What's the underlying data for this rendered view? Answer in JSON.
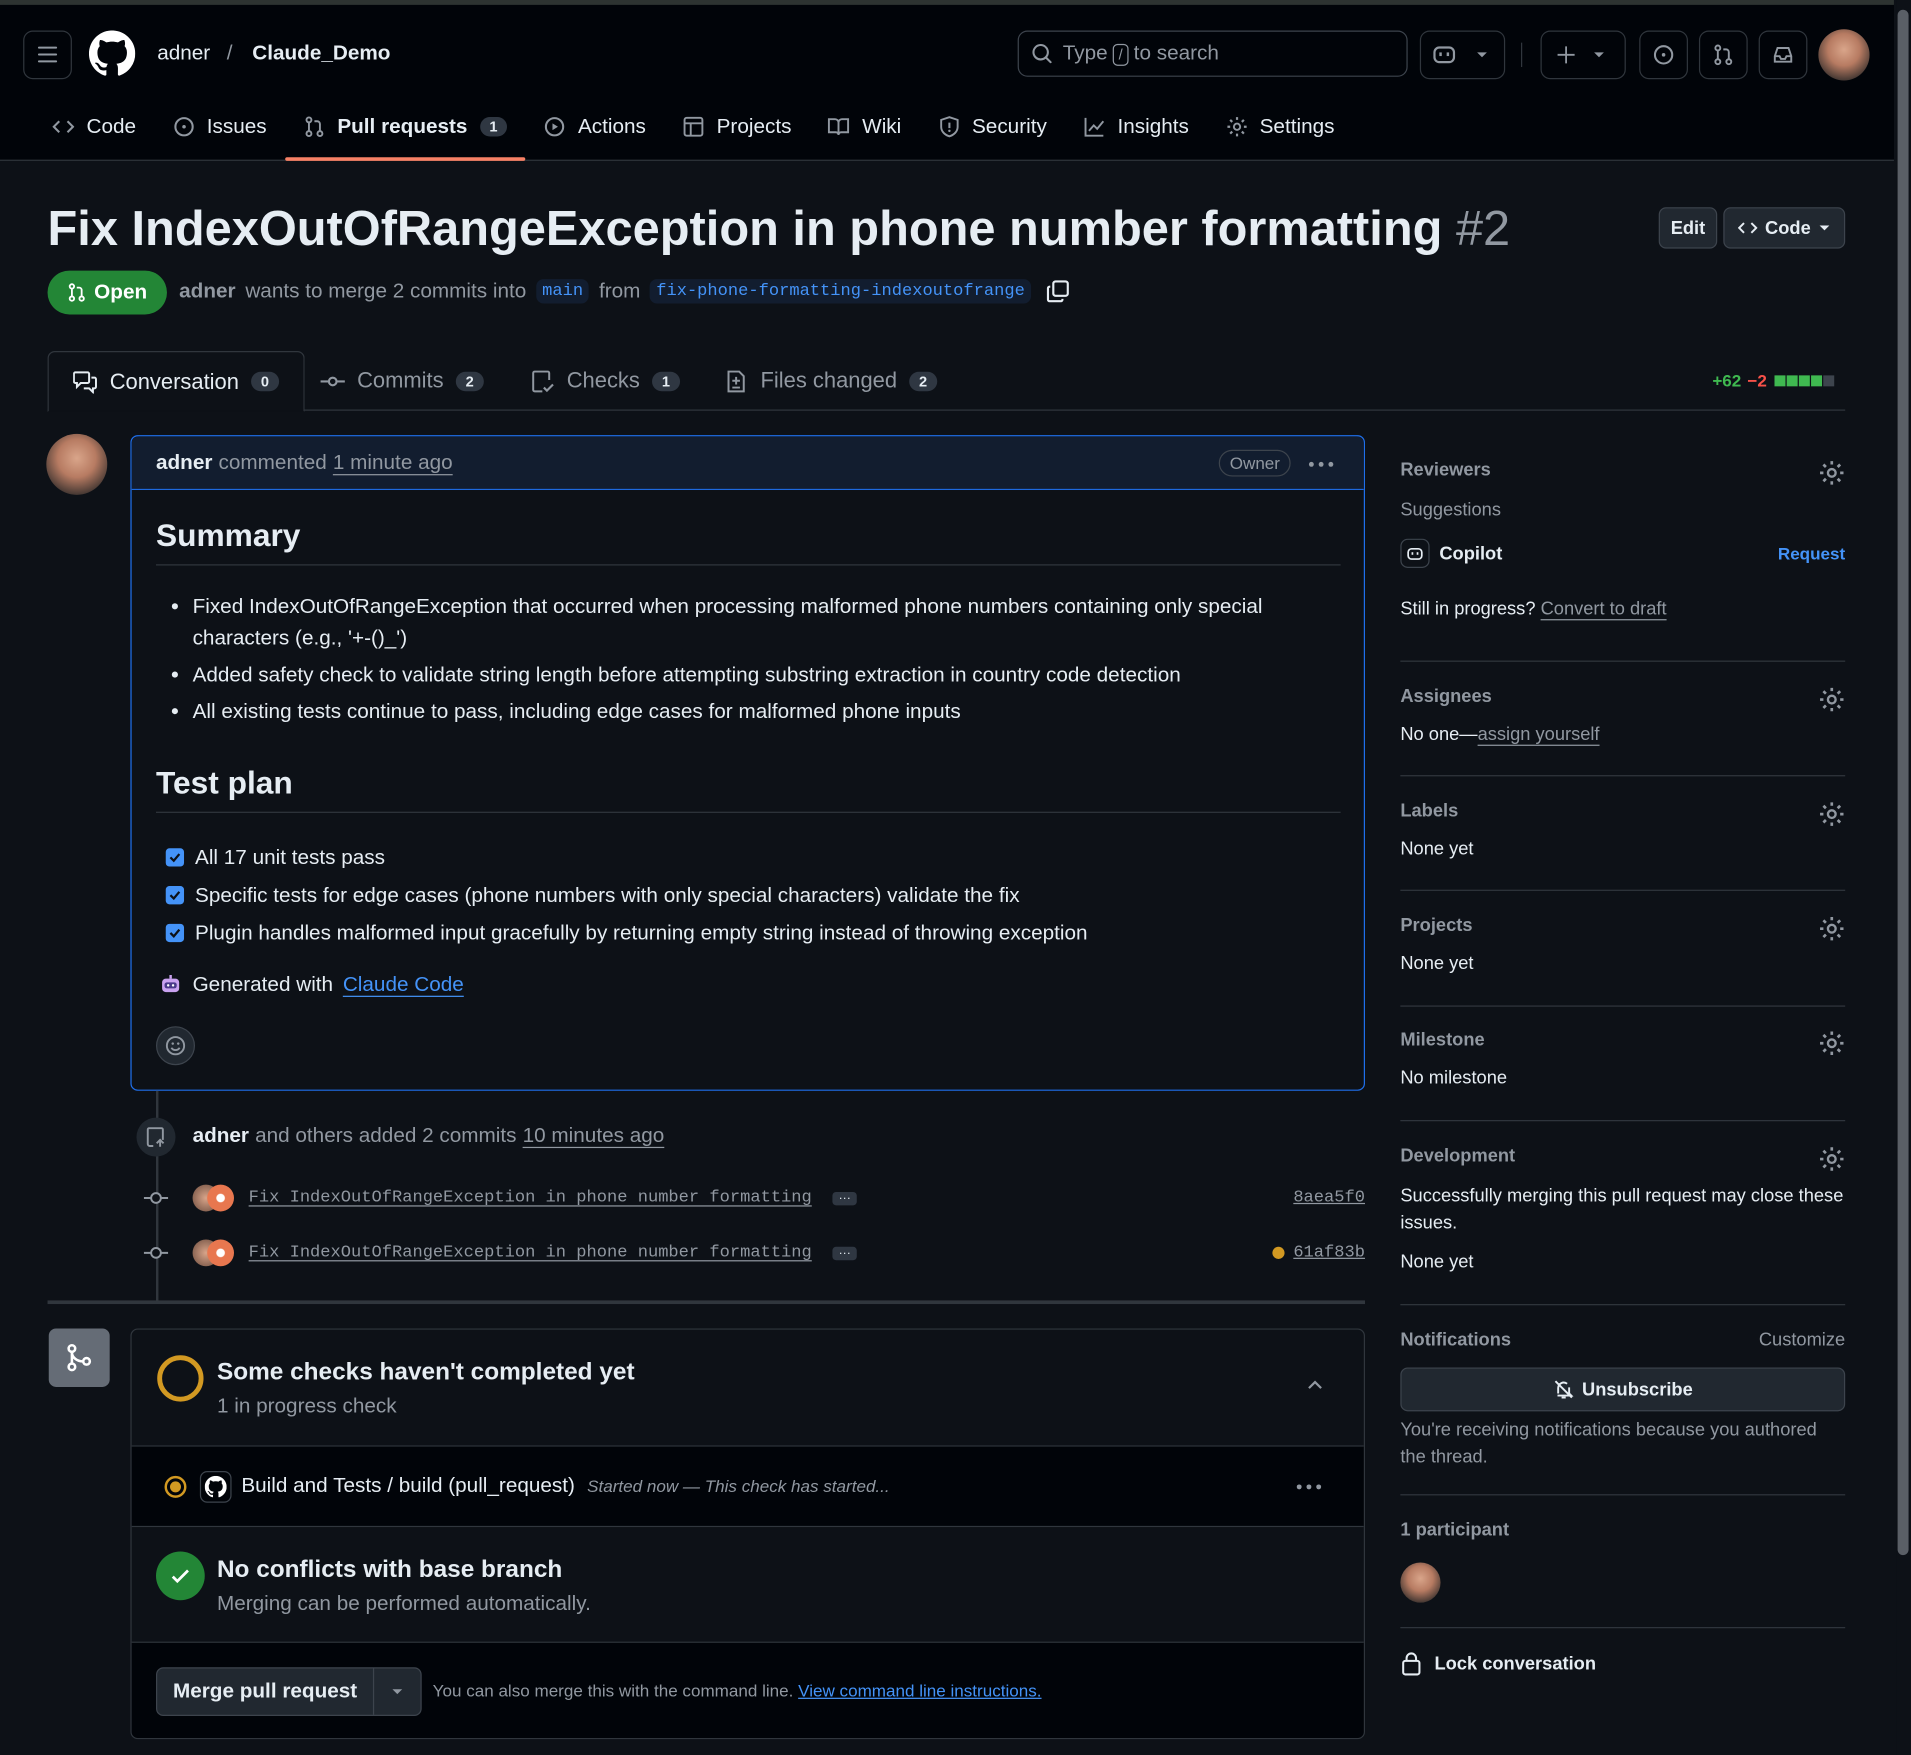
{
  "header": {
    "owner": "adner",
    "separator": "/",
    "repo": "Claude_Demo",
    "search": {
      "prefix": "Type",
      "key": "/",
      "suffix": "to search"
    }
  },
  "repo_tabs": [
    {
      "label": "Code",
      "icon": "code-icon"
    },
    {
      "label": "Issues",
      "icon": "issue-icon"
    },
    {
      "label": "Pull requests",
      "icon": "pull-request-icon",
      "count": "1",
      "active": true
    },
    {
      "label": "Actions",
      "icon": "play-icon"
    },
    {
      "label": "Projects",
      "icon": "table-icon"
    },
    {
      "label": "Wiki",
      "icon": "book-icon"
    },
    {
      "label": "Security",
      "icon": "shield-icon"
    },
    {
      "label": "Insights",
      "icon": "graph-icon"
    },
    {
      "label": "Settings",
      "icon": "gear-icon"
    }
  ],
  "pr": {
    "title": "Fix IndexOutOfRangeException in phone number formatting",
    "number": "#2",
    "edit_label": "Edit",
    "code_label": "Code",
    "state": "Open",
    "author": "adner",
    "merge_text": "wants to merge 2 commits into",
    "base": "main",
    "from_text": "from",
    "head": "fix-phone-formatting-indexoutofrange"
  },
  "pr_tabs": [
    {
      "label": "Conversation",
      "count": "0",
      "active": true
    },
    {
      "label": "Commits",
      "count": "2"
    },
    {
      "label": "Checks",
      "count": "1"
    },
    {
      "label": "Files changed",
      "count": "2"
    }
  ],
  "diffstat": {
    "additions": "+62",
    "deletions": "−2"
  },
  "comment": {
    "author": "adner",
    "action": "commented",
    "time": "1 minute ago",
    "badge": "Owner",
    "summary_heading": "Summary",
    "bullets": [
      "Fixed IndexOutOfRangeException that occurred when processing malformed phone numbers containing only special characters (e.g., '+-()_')",
      "Added safety check to validate string length before attempting substring extraction in country code detection",
      "All existing tests continue to pass, including edge cases for malformed phone inputs"
    ],
    "testplan_heading": "Test plan",
    "tasks": [
      "All 17 unit tests pass",
      "Specific tests for edge cases (phone numbers with only special characters) validate the fix",
      "Plugin handles malformed input gracefully by returning empty string instead of throwing exception"
    ],
    "generated_prefix": "Generated with",
    "generated_link": "Claude Code"
  },
  "commits_event": {
    "author": "adner",
    "text": "and others added 2 commits",
    "time": "10 minutes ago",
    "commits": [
      {
        "message": "Fix IndexOutOfRangeException in phone number formatting",
        "sha": "8aea5f0",
        "pending": false
      },
      {
        "message": "Fix IndexOutOfRangeException in phone number formatting",
        "sha": "61af83b",
        "pending": true
      }
    ]
  },
  "merge": {
    "checks_title": "Some checks haven't completed yet",
    "checks_sub": "1 in progress check",
    "check_name": "Build and Tests / build (pull_request)",
    "check_status": "Started now — This check has started...",
    "conflicts_title": "No conflicts with base branch",
    "conflicts_sub": "Merging can be performed automatically.",
    "merge_button": "Merge pull request",
    "cli_text": "You can also merge this with the command line.",
    "cli_link": "View command line instructions."
  },
  "sidebar": {
    "reviewers": {
      "label": "Reviewers",
      "suggestions": "Suggestions",
      "suggested": "Copilot",
      "request": "Request",
      "draft_q": "Still in progress?",
      "draft_link": "Convert to draft"
    },
    "assignees": {
      "label": "Assignees",
      "none": "No one—",
      "link": "assign yourself"
    },
    "labels": {
      "label": "Labels",
      "value": "None yet"
    },
    "projects": {
      "label": "Projects",
      "value": "None yet"
    },
    "milestone": {
      "label": "Milestone",
      "value": "No milestone"
    },
    "development": {
      "label": "Development",
      "text": "Successfully merging this pull request may close these issues.",
      "value": "None yet"
    },
    "notifications": {
      "label": "Notifications",
      "customize": "Customize",
      "button": "Unsubscribe",
      "reason": "You're receiving notifications because you authored the thread."
    },
    "participants": {
      "label": "1 participant"
    },
    "lock": "Lock conversation"
  },
  "colors": {
    "accent": "#4493f8",
    "open": "#238636",
    "pending": "#d29922",
    "add": "#3fb950",
    "del": "#f85149"
  }
}
